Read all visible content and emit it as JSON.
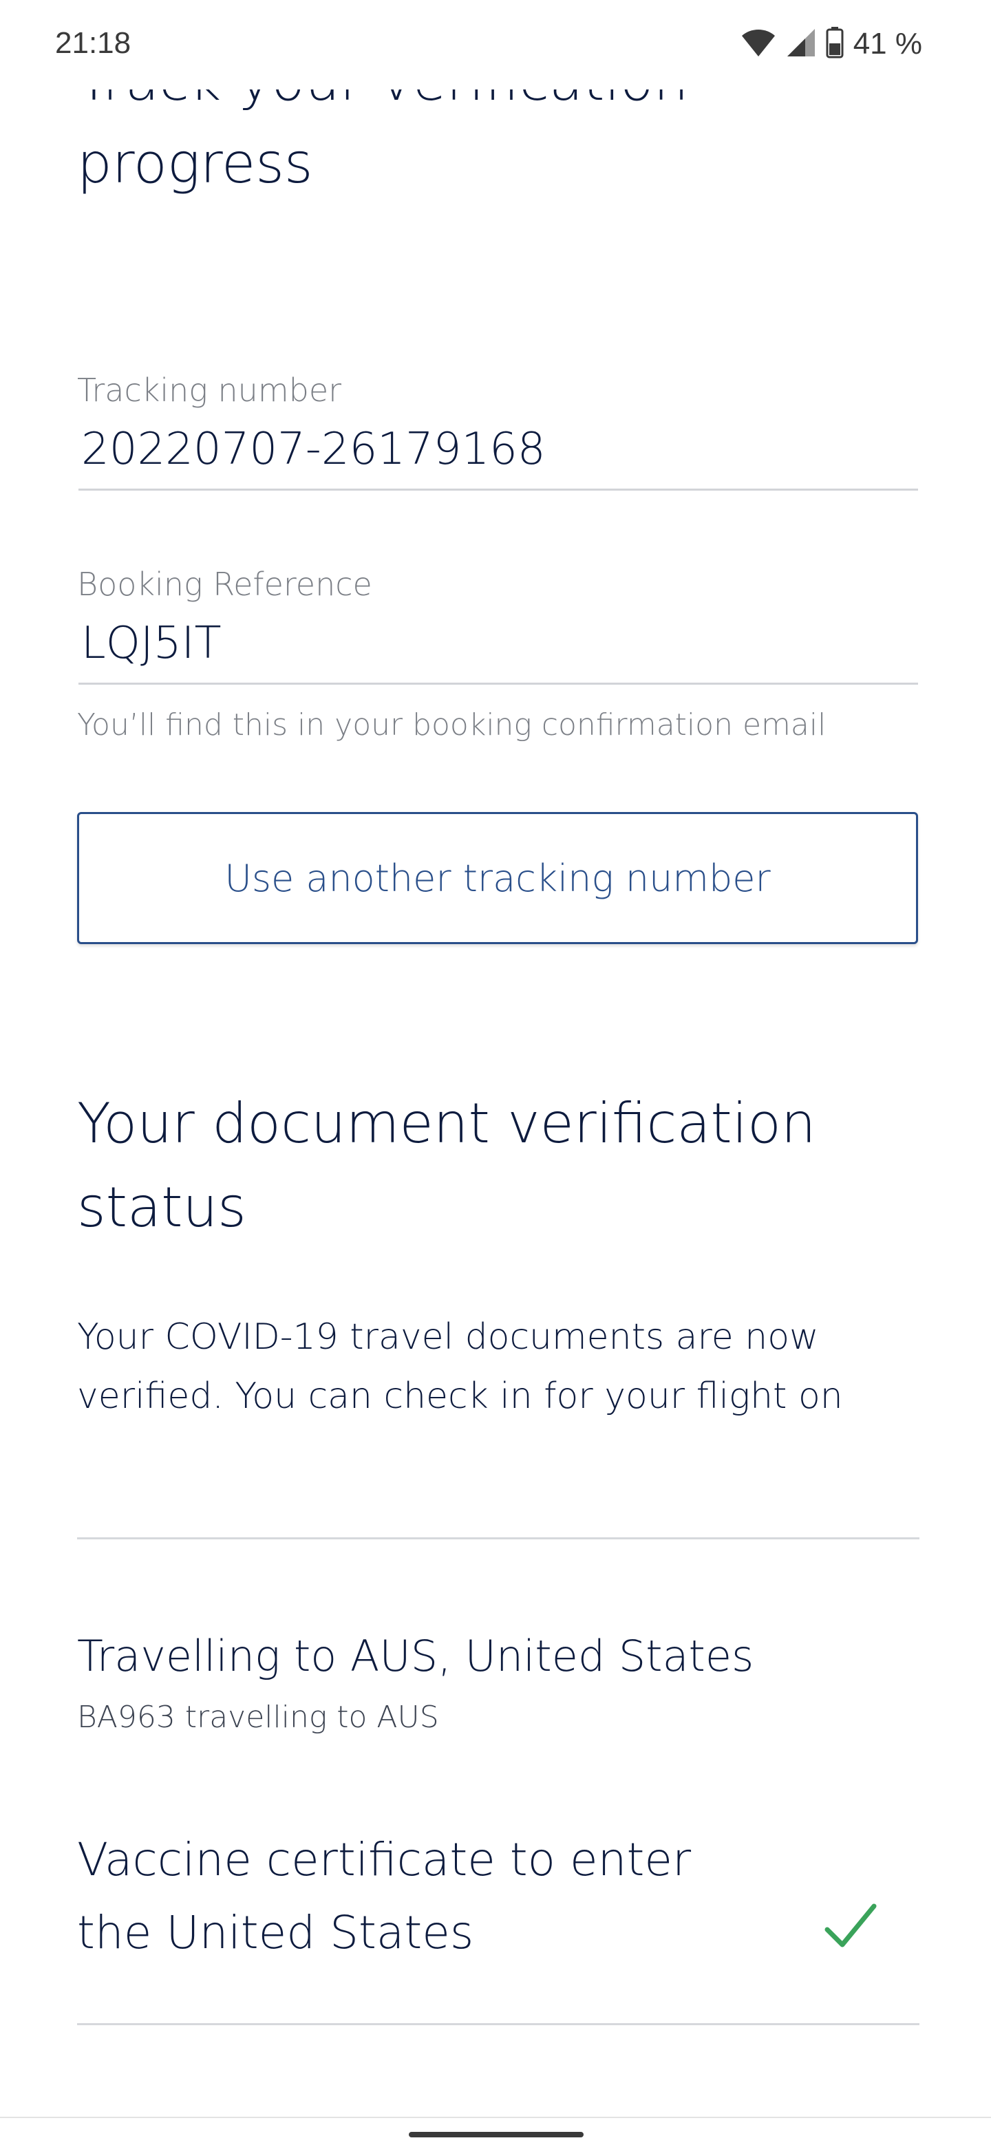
{
  "status_bar": {
    "time": "21:18",
    "battery": "41 %",
    "icons": [
      "wifi-icon",
      "signal-icon",
      "battery-icon"
    ]
  },
  "page": {
    "title": "Track your verification progress"
  },
  "tracking": {
    "tracking_label": "Tracking number",
    "tracking_value": "20220707-26179168",
    "booking_label": "Booking Reference",
    "booking_value": "LQJ5IT",
    "booking_helper": "You’ll find this in your booking confirmation email",
    "another_button_label": "Use another tracking number"
  },
  "verification": {
    "heading": "Your document verification status",
    "message": "Your COVID-19 travel documents are now verified. You can check in for your flight on"
  },
  "trip": {
    "destination_title": "Travelling to AUS, United States",
    "flight_subtitle": "BA963 travelling to AUS",
    "document_title": "Vaccine certificate to enter the United States",
    "document_status_icon": "check-icon"
  },
  "colors": {
    "primary_text": "#0d1b3e",
    "accent_blue": "#2a4f8a",
    "muted_text": "#7b7f86",
    "success_green": "#3aa35a",
    "divider": "#d6d8dc"
  }
}
